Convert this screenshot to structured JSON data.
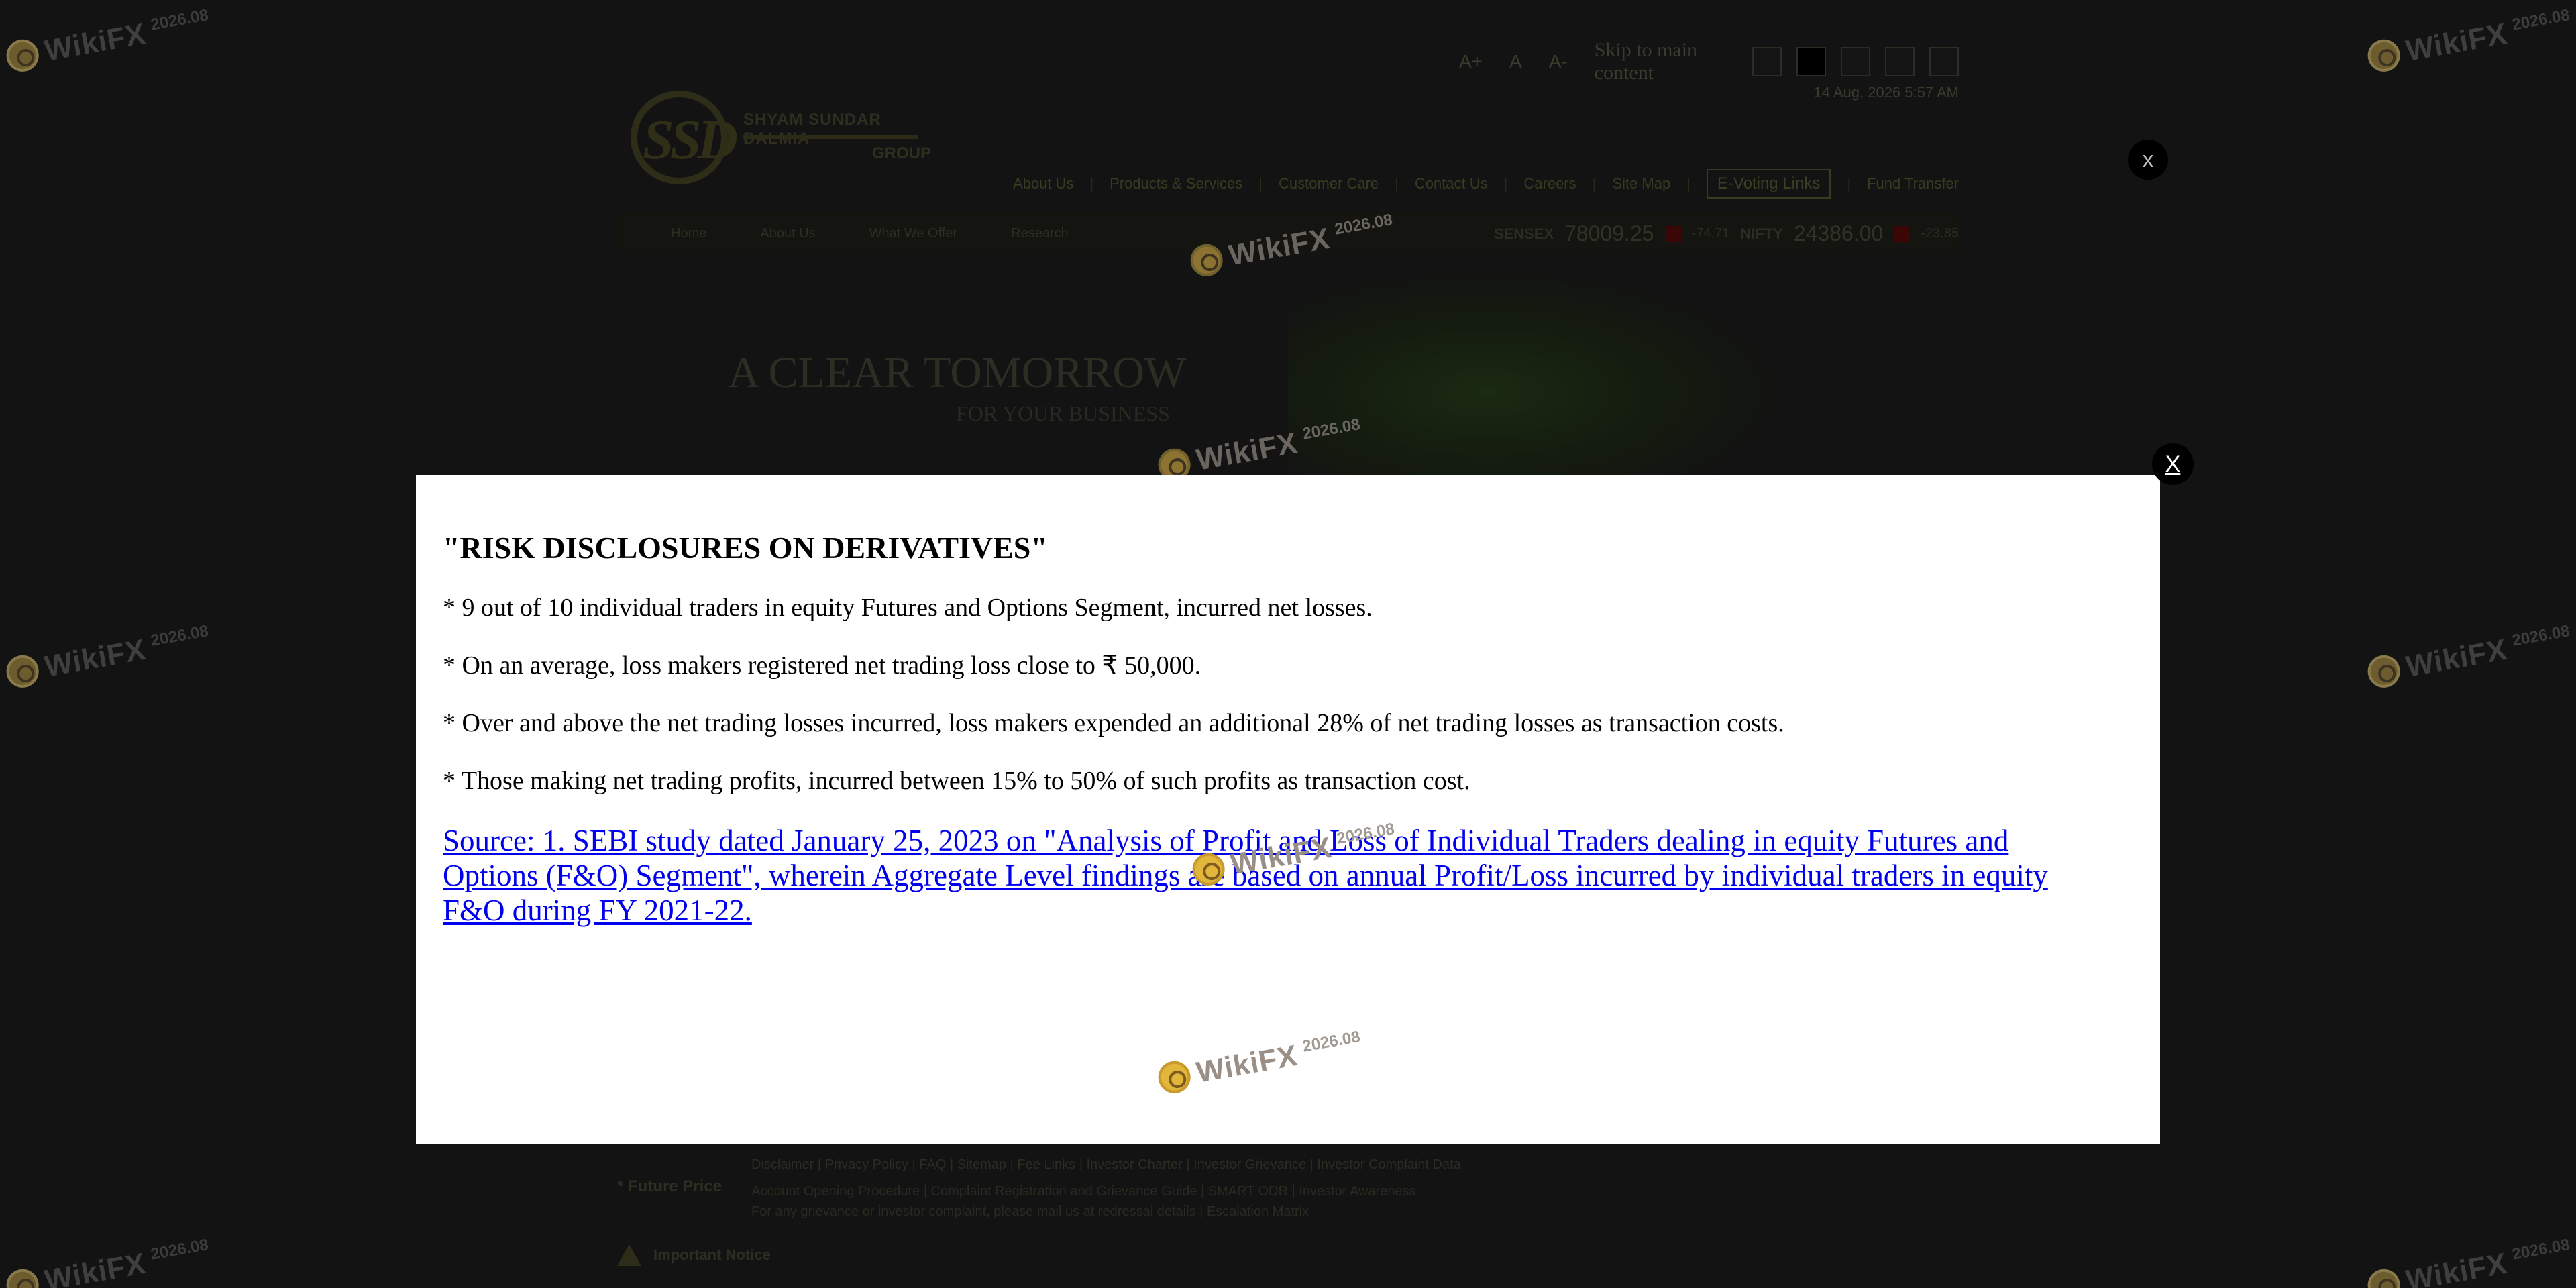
{
  "background_page": {
    "font_controls": [
      "A+",
      "A",
      "A-"
    ],
    "skip_link": "Skip to main content",
    "datetime": "14 Aug, 2026 5:57 AM",
    "logo": {
      "letters": "SSD",
      "name": "SHYAM SUNDAR DALMIA",
      "group": "GROUP"
    },
    "top_nav": [
      "About Us",
      "Products & Services",
      "Customer Care",
      "Contact Us",
      "Careers",
      "Site Map"
    ],
    "evoting": "E-Voting Links",
    "fund_transfer": "Fund Transfer",
    "sub_nav": [
      "Home",
      "About Us",
      "What We Offer",
      "Research"
    ],
    "ticker": {
      "sensex_label": "SENSEX",
      "sensex_value": "78009.25",
      "sensex_change": "-74.71",
      "nifty_label": "NIFTY",
      "nifty_value": "24386.00",
      "nifty_change": "-23.85"
    },
    "hero": {
      "title": "A CLEAR TOMORROW",
      "subtitle": "FOR YOUR BUSINESS"
    },
    "footer": {
      "future_price": "* Future Price",
      "links_line_1": "Disclaimer | Privacy Policy | FAQ | Sitemap | Fee Links | Investor Charter | Investor Grievance | Investor Complaint Data",
      "links_line_2": "Account Opening Procedure | Complaint Registration and Grievance Guide | SMART ODR | Investor Awareness",
      "links_line_3": "For any grievance or investor complaint, please mail us at redressal details | Escalation Matrix",
      "important_notice": "Important Notice"
    },
    "close_label": "x"
  },
  "watermark": {
    "brand": "WikiFX",
    "year": "2026.08"
  },
  "modal": {
    "close_label": "X",
    "title": "\"RISK DISCLOSURES ON DERIVATIVES\"",
    "points": [
      "* 9 out of 10 individual traders in equity Futures and Options Segment, incurred net losses.",
      "* On an average, loss makers registered net trading loss close to ₹ 50,000.",
      "* Over and above the net trading losses incurred, loss makers expended an additional 28% of net trading losses as transaction costs.",
      "* Those making net trading profits, incurred between 15% to 50% of such profits as transaction cost."
    ],
    "source": "Source: 1. SEBI study dated January 25, 2023 on \"Analysis of Profit and Loss of Individual Traders dealing in equity Futures and Options (F&O) Segment\", wherein Aggregate Level findings are based on annual Profit/Loss incurred by individual traders in equity F&O during FY 2021-22."
  },
  "colors": {
    "overlay": "#131313",
    "modal_background": "#ffffff",
    "link": "#0000ee",
    "close_button": "#000000"
  }
}
